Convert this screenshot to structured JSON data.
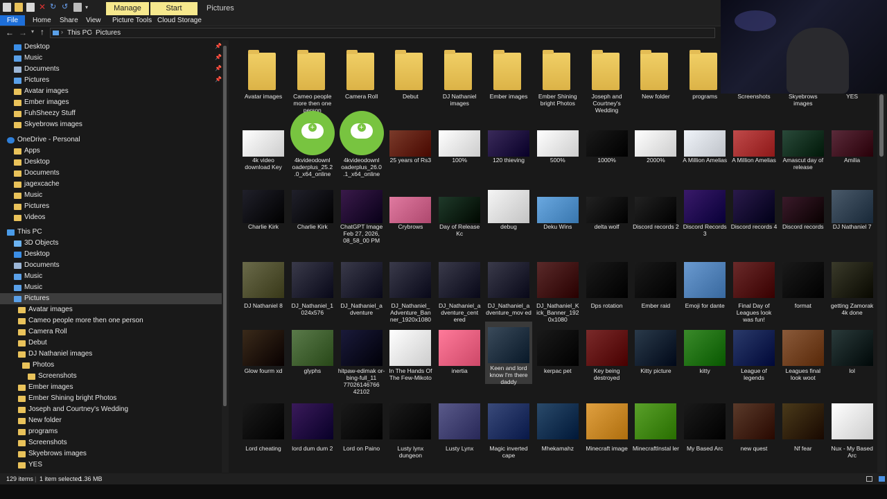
{
  "titlebar": {
    "manage": "Manage",
    "start_onedrive": "Start OneDrive",
    "window_title": "Pictures"
  },
  "ribbon": {
    "tabs": [
      "File",
      "Home",
      "Share",
      "View",
      "Picture Tools",
      "Cloud Storage"
    ]
  },
  "address": {
    "crumbs": [
      "This PC",
      "Pictures"
    ]
  },
  "nav": [
    {
      "label": "Desktop",
      "icon": "desktop-icon",
      "pinned": true
    },
    {
      "label": "Music",
      "icon": "music-icon",
      "pinned": true
    },
    {
      "label": "Documents",
      "icon": "documents-icon",
      "pinned": true
    },
    {
      "label": "Pictures",
      "icon": "pictures-icon",
      "pinned": true
    },
    {
      "label": "Avatar images",
      "icon": "folder-icon"
    },
    {
      "label": "Ember images",
      "icon": "folder-icon"
    },
    {
      "label": "FuhSheezy Stuff",
      "icon": "folder-icon"
    },
    {
      "label": "Skyebrows images",
      "icon": "folder-icon"
    },
    {
      "label": "OneDrive - Personal",
      "icon": "cloud-icon"
    },
    {
      "label": "Apps",
      "icon": "folder-icon"
    },
    {
      "label": "Desktop",
      "icon": "folder-icon"
    },
    {
      "label": "Documents",
      "icon": "folder-icon"
    },
    {
      "label": "jagexcache",
      "icon": "folder-icon"
    },
    {
      "label": "Music",
      "icon": "folder-icon"
    },
    {
      "label": "Pictures",
      "icon": "folder-icon"
    },
    {
      "label": "Videos",
      "icon": "folder-icon"
    },
    {
      "label": "This PC",
      "icon": "computer-icon"
    },
    {
      "label": "3D Objects",
      "icon": "3d-objects-icon"
    },
    {
      "label": "Desktop",
      "icon": "desktop-icon"
    },
    {
      "label": "Documents",
      "icon": "documents-icon"
    },
    {
      "label": "Music",
      "icon": "music-icon"
    },
    {
      "label": "Music",
      "icon": "music-icon"
    },
    {
      "label": "Pictures",
      "icon": "pictures-icon",
      "selected": true
    },
    {
      "label": "Avatar images",
      "icon": "folder-icon"
    },
    {
      "label": "Cameo people more then one person",
      "icon": "folder-icon"
    },
    {
      "label": "Camera Roll",
      "icon": "folder-icon"
    },
    {
      "label": "Debut",
      "icon": "folder-icon"
    },
    {
      "label": "DJ Nathaniel images",
      "icon": "folder-icon"
    },
    {
      "label": "Photos",
      "icon": "folder-icon"
    },
    {
      "label": "Screenshots",
      "icon": "folder-icon"
    },
    {
      "label": "Ember images",
      "icon": "folder-icon"
    },
    {
      "label": "Ember Shining bright Photos",
      "icon": "folder-icon"
    },
    {
      "label": "Joseph and Courtney's Wedding",
      "icon": "folder-icon"
    },
    {
      "label": "New folder",
      "icon": "folder-icon"
    },
    {
      "label": "programs",
      "icon": "folder-icon"
    },
    {
      "label": "Screenshots",
      "icon": "folder-icon"
    },
    {
      "label": "Skyebrows images",
      "icon": "folder-icon"
    },
    {
      "label": "YES",
      "icon": "folder-icon"
    }
  ],
  "files": [
    [
      "Avatar images",
      "Cameo people more then one person",
      "Camera Roll",
      "Debut",
      "DJ Nathaniel images",
      "Ember images",
      "Ember Shining bright Photos",
      "Joseph and Courtney's Wedding",
      "New folder",
      "programs",
      "Screenshots",
      "Skyebrows images",
      "YES"
    ],
    [
      "4k video download Key",
      "4kvideodownl oaderplus_25.2 .0_x64_online",
      "4kvideodownl oaderplus_26.0 .1_x64_online",
      "25 years of Rs3",
      "100%",
      "120 thieving",
      "500%",
      "1000%",
      "2000%",
      "A Million Amelias",
      "A Million Amelias",
      "Amascut day of release",
      "Amilia"
    ],
    [
      "Charlie Kirk",
      "Charlie Kirk",
      "ChatGPT Image Feb 27, 2026, 08_58_00 PM",
      "Crybrows",
      "Day of Release Kc",
      "debug",
      "Deku Wins",
      "delta wolf",
      "Discord records 2",
      "Discord Records 3",
      "Discord records 4",
      "Discord records",
      "DJ Nathaniel 7"
    ],
    [
      "DJ Nathaniel 8",
      "DJ_Nathaniel_1 024x576",
      "DJ_Nathaniel_a dventure",
      "DJ_Nathaniel_ Adventure_Ban ner_1920x1080",
      "DJ_Nathaniel_a dventure_cent ered",
      "DJ_Nathaniel_a dventure_mov ed",
      "DJ_Nathaniel_K ick_Banner_192 0x1080",
      "Dps rotation",
      "Ember raid",
      "Emoji for dante",
      "Final Day of Leagues look was fun!",
      "format",
      "getting Zamorak 4k done"
    ],
    [
      "Glow fourm xd",
      "glyphs",
      "hitpaw-edimak or-bing-full_11 77026146766 42102",
      "In The Hands Of The Few-Mikoto",
      "inertia",
      "Keen and lord know I'm there daddy",
      "kerpac pet",
      "Key being destroyed",
      "Kitty picture",
      "kitty",
      "League of legends",
      "Leagues final look woot",
      "lol"
    ],
    [
      "Lord cheating",
      "lord dum dum 2",
      "Lord on Paino",
      "Lusty lynx dungeon",
      "Lusty Lynx",
      "Magic inverted cape",
      "Mhekamahz",
      "Minecraft image",
      "MinecraftInstal ler",
      "My Based Arc",
      "new quest",
      "Nf fear",
      "Nux - My Based Arc"
    ]
  ],
  "status": {
    "count": "129 items",
    "selected": "1 item selected",
    "size": "1.36 MB"
  }
}
